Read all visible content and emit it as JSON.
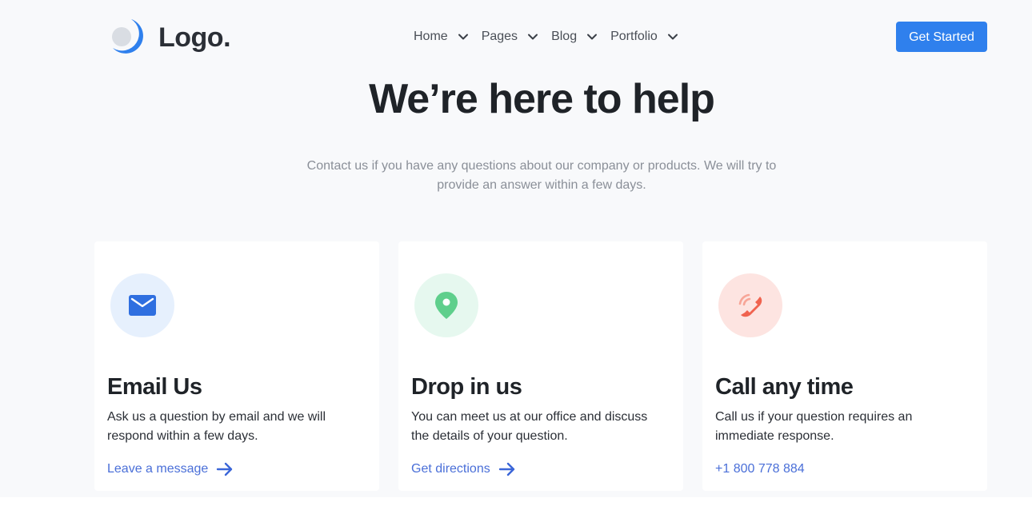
{
  "header": {
    "logo_text": "Logo.",
    "nav": [
      {
        "label": "Home",
        "icon": "chevron-down-icon"
      },
      {
        "label": "Pages",
        "icon": "chevron-down-icon"
      },
      {
        "label": "Blog",
        "icon": "chevron-down-icon"
      },
      {
        "label": "Portfolio",
        "icon": "chevron-down-icon"
      }
    ],
    "cta_label": "Get Started"
  },
  "hero": {
    "title": "We’re here to help",
    "subtitle": "Contact us if you have any questions about our company or products. We will try to provide an answer within a few days."
  },
  "cards": [
    {
      "icon": "mail-icon",
      "title": "Email Us",
      "description": "Ask us a question by email and we will respond within a few days.",
      "link": "Leave a message",
      "link_icon": "arrow-right-icon"
    },
    {
      "icon": "map-pin-icon",
      "title": "Drop in us",
      "description": "You can meet us at our office and discuss the details of your question.",
      "link": "Get directions",
      "link_icon": "arrow-right-icon"
    },
    {
      "icon": "phone-icon",
      "title": "Call any time",
      "description": "Call us if your question requires an immediate response.",
      "link": "+1 800 778 884"
    }
  ],
  "colors": {
    "accent": "#2f80ed",
    "link": "#4a6fd8",
    "background": "#f8f9fb",
    "mail_icon_bg": "#e6f0fd",
    "pin_icon_bg": "#e6f8ef",
    "phone_icon_bg": "#fde4e1"
  }
}
